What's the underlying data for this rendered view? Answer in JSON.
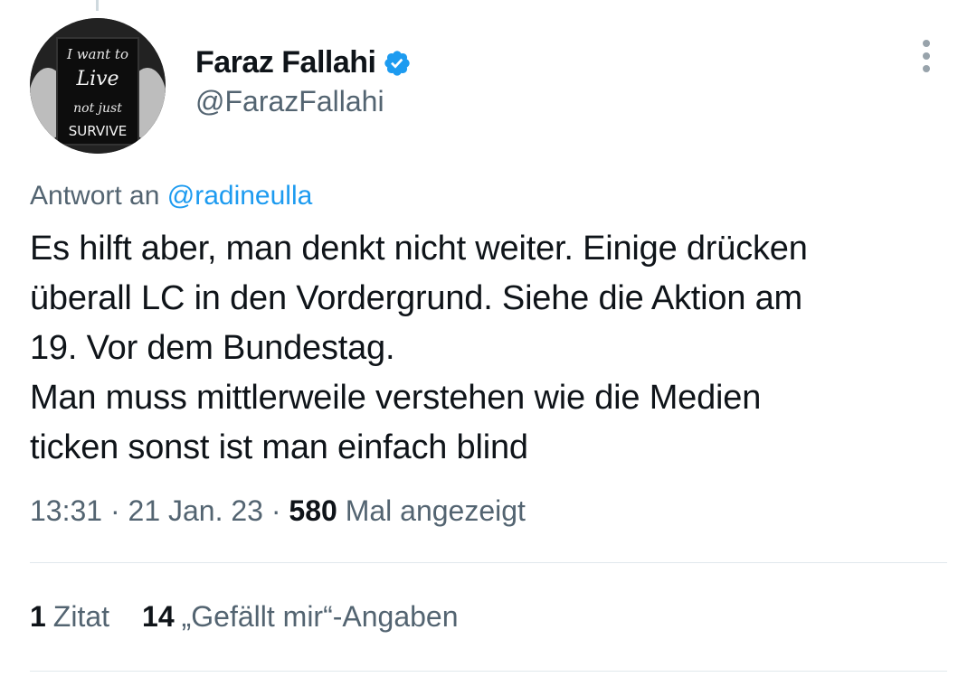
{
  "author": {
    "display_name": "Faraz Fallahi",
    "handle": "@FarazFallahi",
    "verified": true,
    "avatar_sign": {
      "line1": "I want to",
      "line2": "Live",
      "line3": "not just",
      "line4": "SURVIVE"
    }
  },
  "reply": {
    "prefix": "Antwort an",
    "mention": "@radineulla"
  },
  "tweet": {
    "text": "Es hilft aber, man denkt nicht weiter. Einige drücken\nüberall LC in den Vordergrund. Siehe die Aktion am\n19. Vor dem Bundestag.\nMan muss mittlerweile verstehen wie die Medien\nticken sonst ist man einfach blind"
  },
  "meta": {
    "time": "13:31",
    "separator": "·",
    "date": "21 Jan. 23",
    "views_count": "580",
    "views_label": "Mal angezeigt"
  },
  "stats": {
    "quotes_count": "1",
    "quotes_label": "Zitat",
    "likes_count": "14",
    "likes_label": "„Gefällt mir“-Angaben"
  },
  "colors": {
    "link": "#1d9bf0",
    "muted": "#536471",
    "text": "#0f1419",
    "verified": "#1d9bf0"
  }
}
